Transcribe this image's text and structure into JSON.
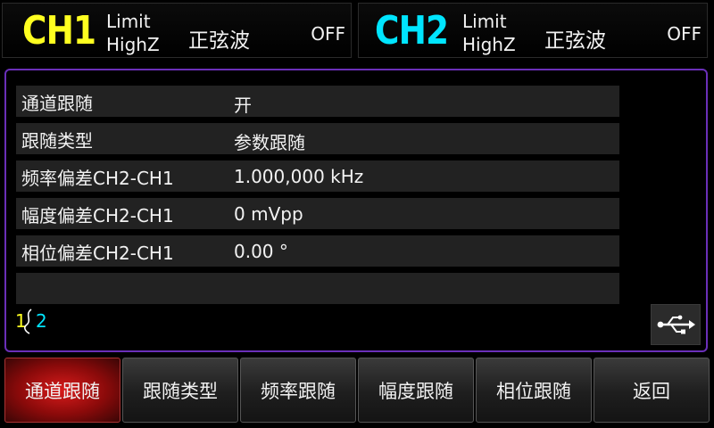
{
  "header": {
    "ch1": {
      "name": "CH1",
      "limit": "Limit",
      "impedance": "HighZ",
      "waveform": "正弦波",
      "state": "OFF",
      "color": "#ffff20"
    },
    "ch2": {
      "name": "CH2",
      "limit": "Limit",
      "impedance": "HighZ",
      "waveform": "正弦波",
      "state": "OFF",
      "color": "#00e5ff"
    }
  },
  "settings": {
    "rows": [
      {
        "label": "通道跟随",
        "value": "开"
      },
      {
        "label": "跟随类型",
        "value": "参数跟随"
      },
      {
        "label": "频率偏差CH2-CH1",
        "value": "1.000,000 kHz"
      },
      {
        "label": "幅度偏差CH2-CH1",
        "value": "0 mVpp"
      },
      {
        "label": "相位偏差CH2-CH1",
        "value": "0.00 °"
      },
      {
        "label": "",
        "value": ""
      }
    ]
  },
  "pager": {
    "page1": "1",
    "page2": "2"
  },
  "status": {
    "usb_icon": "usb-icon"
  },
  "softkeys": [
    {
      "label": "通道跟随",
      "active": true
    },
    {
      "label": "跟随类型"
    },
    {
      "label": "频率跟随"
    },
    {
      "label": "幅度跟随"
    },
    {
      "label": "相位跟随"
    },
    {
      "label": "返回"
    }
  ],
  "colors": {
    "accent_border": "#6a2fb8",
    "active_softkey": "#d81b1b"
  }
}
